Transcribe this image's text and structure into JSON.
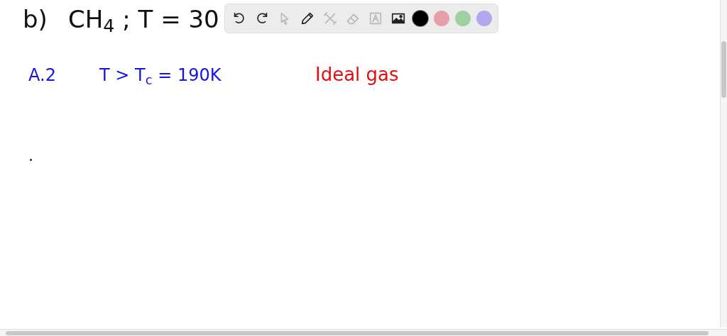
{
  "canvas": {
    "notes": [
      {
        "text": "b)",
        "color": "#111111"
      },
      {
        "text": "CH$_{4}$ ; T = 30",
        "color": "#111111"
      },
      {
        "text": "A.2",
        "color": "#1515e0"
      },
      {
        "text": "T > T$_{c}$ = 190K",
        "color": "#1515e0"
      },
      {
        "text": "Ideal gas",
        "color": "#e01010"
      }
    ]
  },
  "toolbar": {
    "tools": [
      {
        "kind": "undo",
        "disabled": false
      },
      {
        "kind": "redo",
        "disabled": false
      },
      {
        "kind": "pointer",
        "disabled": true
      },
      {
        "kind": "pen",
        "disabled": false
      },
      {
        "kind": "tools",
        "disabled": true
      },
      {
        "kind": "eraser",
        "disabled": true
      },
      {
        "kind": "text",
        "disabled": true
      },
      {
        "kind": "image",
        "disabled": false
      }
    ],
    "colors": [
      {
        "color": "#000000",
        "selected": true
      },
      {
        "color": "#e8a0a8",
        "selected": false
      },
      {
        "color": "#a0d0a0",
        "selected": false
      },
      {
        "color": "#b0a8ec",
        "selected": false
      }
    ]
  }
}
